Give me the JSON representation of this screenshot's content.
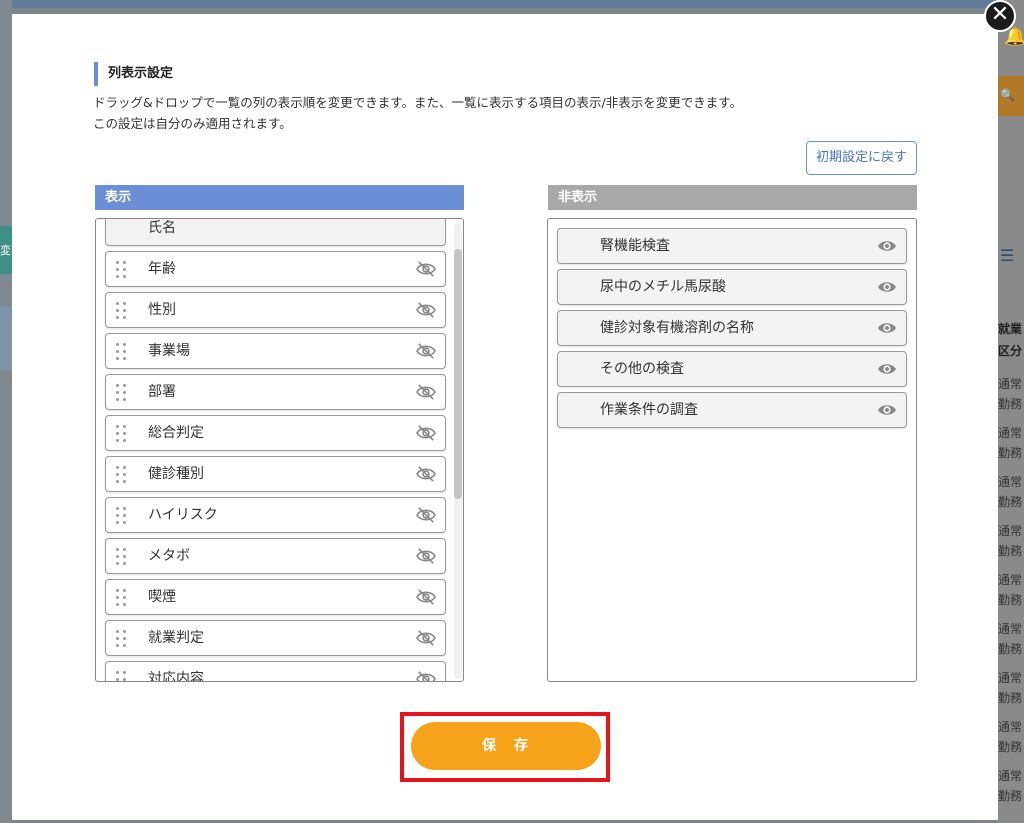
{
  "background": {
    "right_header": "就業区分",
    "right_rows": [
      "通常勤務",
      "通常勤務",
      "通常勤務",
      "通常勤務",
      "通常勤務",
      "通常勤務",
      "通常勤務",
      "通常勤務",
      "通常勤務"
    ],
    "left_button": "変"
  },
  "modal": {
    "close_label": "✕",
    "title": "列表示設定",
    "description_line1": "ドラッグ&ドロップで一覧の列の表示順を変更できます。また、一覧に表示する項目の表示/非表示を変更できます。",
    "description_line2": "この設定は自分のみ適用されます。",
    "reset_label": "初期設定に戻す",
    "shown_header": "表示",
    "hidden_header": "非表示",
    "shown_items": [
      {
        "label": "氏名",
        "fixed": true
      },
      {
        "label": "年齢"
      },
      {
        "label": "性別"
      },
      {
        "label": "事業場"
      },
      {
        "label": "部署"
      },
      {
        "label": "総合判定"
      },
      {
        "label": "健診種別"
      },
      {
        "label": "ハイリスク"
      },
      {
        "label": "メタボ"
      },
      {
        "label": "喫煙"
      },
      {
        "label": "就業判定"
      },
      {
        "label": "対応内容"
      }
    ],
    "hidden_items": [
      {
        "label": "腎機能検査"
      },
      {
        "label": "尿中のメチル馬尿酸"
      },
      {
        "label": "健診対象有機溶剤の名称"
      },
      {
        "label": "その他の検査"
      },
      {
        "label": "作業条件の調査"
      }
    ],
    "save_label": "保　存"
  },
  "colors": {
    "accent_blue": "#6b8fd6",
    "save_orange": "#f7a21b",
    "highlight_red": "#e8141c",
    "hidden_header_gray": "#a8a8a8"
  },
  "icons": {
    "shown_item_icon": "eye-slash-icon",
    "hidden_item_icon": "eye-icon",
    "drag_icon": "drag-handle-icon"
  }
}
